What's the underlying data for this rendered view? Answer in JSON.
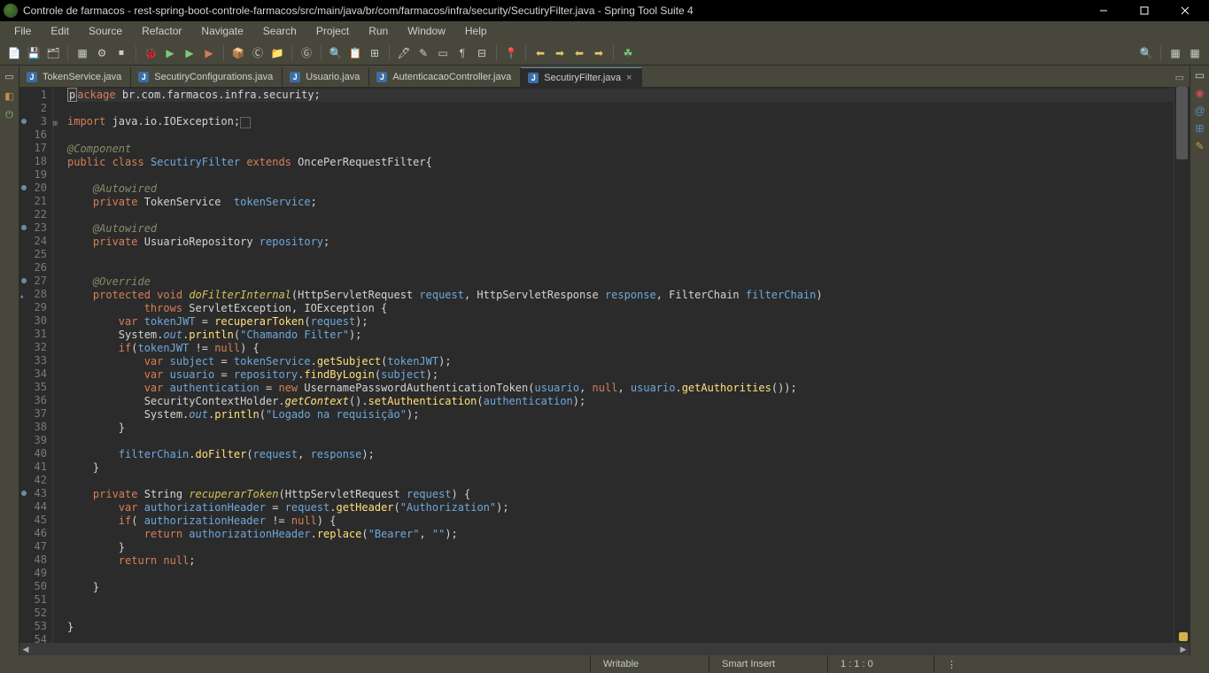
{
  "window": {
    "title": "Controle de farmacos - rest-spring-boot-controle-farmacos/src/main/java/br/com/farmacos/infra/security/SecutiryFilter.java - Spring Tool Suite 4"
  },
  "menu": [
    "File",
    "Edit",
    "Source",
    "Refactor",
    "Navigate",
    "Search",
    "Project",
    "Run",
    "Window",
    "Help"
  ],
  "tabs": [
    {
      "label": "TokenService.java",
      "active": false
    },
    {
      "label": "SecutiryConfigurations.java",
      "active": false
    },
    {
      "label": "Usuario.java",
      "active": false
    },
    {
      "label": "AutenticacaoController.java",
      "active": false
    },
    {
      "label": "SecutiryFilter.java",
      "active": true
    }
  ],
  "lines": [
    {
      "n": 1,
      "html": "<span class='highlight-line'><span class='cursor-box'>p</span><span class='kw'>ackage</span> br.com.farmacos.infra.security;</span>"
    },
    {
      "n": 2,
      "html": ""
    },
    {
      "n": 3,
      "marker": true,
      "fold": "+",
      "html": "<span class='kw'>import</span> java.io.IOException;<span class='collapsed-box'>&nbsp;</span>"
    },
    {
      "n": 16,
      "html": ""
    },
    {
      "n": 17,
      "html": "<span class='ann'>@Component</span>"
    },
    {
      "n": 18,
      "html": "<span class='kw'>public class</span> <span class='type'>SecutiryFilter</span> <span class='kw'>extends</span> <span class='plain'>OncePerRequestFilter</span>{"
    },
    {
      "n": 19,
      "html": ""
    },
    {
      "n": 20,
      "marker": true,
      "html": "    <span class='ann'>@Autowired</span>"
    },
    {
      "n": 21,
      "html": "    <span class='kw'>private</span> <span class='plain'>TokenService</span>  <span class='field'>tokenService</span>;"
    },
    {
      "n": 22,
      "html": ""
    },
    {
      "n": 23,
      "marker": true,
      "html": "    <span class='ann'>@Autowired</span>"
    },
    {
      "n": 24,
      "html": "    <span class='kw'>private</span> <span class='plain'>UsuarioRepository</span> <span class='field'>repository</span>;"
    },
    {
      "n": 25,
      "html": ""
    },
    {
      "n": 26,
      "html": ""
    },
    {
      "n": 27,
      "marker": true,
      "html": "    <span class='ann'>@Override</span>"
    },
    {
      "n": 28,
      "override": true,
      "html": "    <span class='kw'>protected</span> <span class='kw'>void</span> <span class='decl'>doFilterInternal</span>(HttpServletRequest <span class='field'>request</span>, HttpServletResponse <span class='field'>response</span>, FilterChain <span class='field'>filterChain</span>)"
    },
    {
      "n": 29,
      "html": "            <span class='kw'>throws</span> <span class='plain'>ServletException</span>, <span class='plain'>IOException</span> {"
    },
    {
      "n": 30,
      "html": "        <span class='kw'>var</span> <span class='field'>tokenJWT</span> = <span class='method'>recuperarToken</span>(<span class='field'>request</span>);"
    },
    {
      "n": 31,
      "html": "        System.<span class='field static-it'>out</span>.<span class='method'>println</span>(<span class='str'>\"Chamando Filter\"</span>);"
    },
    {
      "n": 32,
      "html": "        <span class='kw'>if</span>(<span class='field'>tokenJWT</span> != <span class='kw'>null</span>) {"
    },
    {
      "n": 33,
      "html": "            <span class='kw'>var</span> <span class='field'>subject</span> = <span class='field'>tokenService</span>.<span class='method'>getSubject</span>(<span class='field'>tokenJWT</span>);"
    },
    {
      "n": 34,
      "html": "            <span class='kw'>var</span> <span class='field'>usuario</span> = <span class='field'>repository</span>.<span class='method'>findByLogin</span>(<span class='field'>subject</span>);"
    },
    {
      "n": 35,
      "html": "            <span class='kw'>var</span> <span class='field'>authentication</span> = <span class='kw'>new</span> <span class='plain'>UsernamePasswordAuthenticationToken</span>(<span class='field'>usuario</span>, <span class='kw'>null</span>, <span class='field'>usuario</span>.<span class='method'>getAuthorities</span>());"
    },
    {
      "n": 36,
      "html": "            SecurityContextHolder.<span class='method static-it'>getContext</span>().<span class='method'>setAuthentication</span>(<span class='field'>authentication</span>);"
    },
    {
      "n": 37,
      "html": "            System.<span class='field static-it'>out</span>.<span class='method'>println</span>(<span class='str'>\"Logado na requisição\"</span>);"
    },
    {
      "n": 38,
      "html": "        }"
    },
    {
      "n": 39,
      "html": ""
    },
    {
      "n": 40,
      "html": "        <span class='field'>filterChain</span>.<span class='method'>doFilter</span>(<span class='field'>request</span>, <span class='field'>response</span>);"
    },
    {
      "n": 41,
      "html": "    }"
    },
    {
      "n": 42,
      "html": ""
    },
    {
      "n": 43,
      "marker": true,
      "html": "    <span class='kw'>private</span> <span class='plain'>String</span> <span class='decl'>recuperarToken</span>(HttpServletRequest <span class='field'>request</span>) {"
    },
    {
      "n": 44,
      "html": "        <span class='kw'>var</span> <span class='field'>authorizationHeader</span> = <span class='field'>request</span>.<span class='method'>getHeader</span>(<span class='str'>\"Authorization\"</span>);"
    },
    {
      "n": 45,
      "html": "        <span class='kw'>if</span>( <span class='field'>authorizationHeader</span> != <span class='kw'>null</span>) {"
    },
    {
      "n": 46,
      "html": "            <span class='kw'>return</span> <span class='field'>authorizationHeader</span>.<span class='method'>replace</span>(<span class='str'>\"Bearer\"</span>, <span class='str'>\"\"</span>);"
    },
    {
      "n": 47,
      "html": "        }"
    },
    {
      "n": 48,
      "html": "        <span class='kw'>return</span> <span class='kw'>null</span>;"
    },
    {
      "n": 49,
      "html": ""
    },
    {
      "n": 50,
      "html": "    }"
    },
    {
      "n": 51,
      "html": ""
    },
    {
      "n": 52,
      "html": ""
    },
    {
      "n": 53,
      "html": "}"
    },
    {
      "n": 54,
      "html": ""
    }
  ],
  "status": {
    "writable": "Writable",
    "insert": "Smart Insert",
    "cursor": "1 : 1 : 0"
  }
}
